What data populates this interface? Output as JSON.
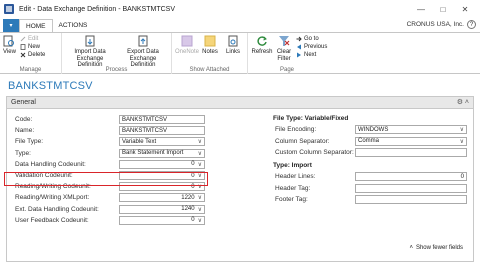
{
  "window": {
    "title": "Edit - Data Exchange Definition - BANKSTMTCSV",
    "minimize": "—",
    "maximize": "□",
    "close": "✕"
  },
  "tabs": [
    "HOME",
    "ACTIONS"
  ],
  "menu_icon": "▾",
  "company": "CRONUS USA, Inc.",
  "help_icon": "?",
  "ribbon": {
    "manage": {
      "label": "Manage",
      "view": "View",
      "edit": "Edit",
      "new": "New",
      "delete": "Delete"
    },
    "process": {
      "label": "Process",
      "import": "Import Data Exchange Definition",
      "export": "Export Data Exchange Definition"
    },
    "show_attached": {
      "label": "Show Attached",
      "onenote": "OneNote",
      "notes": "Notes",
      "links": "Links"
    },
    "page": {
      "label": "Page",
      "refresh": "Refresh",
      "clear_filter": "Clear Filter",
      "goto": "Go to",
      "previous": "Previous",
      "next": "Next"
    }
  },
  "page_title": "BANKSTMTCSV",
  "general": {
    "header": "General",
    "header_icons": "⚙ ˄",
    "left_fields": [
      {
        "label": "Code:",
        "value": "BANKSTMTCSV",
        "type": "text"
      },
      {
        "label": "Name:",
        "value": "BANKSTMTCSV",
        "type": "text"
      },
      {
        "label": "File Type:",
        "value": "Variable Text",
        "type": "select"
      },
      {
        "label": "Type:",
        "value": "Bank Statement Import",
        "type": "select"
      },
      {
        "label": "Data Handling Codeunit:",
        "value": "0",
        "type": "num"
      },
      {
        "label": "Validation Codeunit:",
        "value": "0",
        "type": "num"
      },
      {
        "label": "Reading/Writing Codeunit:",
        "value": "0",
        "type": "num"
      },
      {
        "label": "Reading/Writing XMLport:",
        "value": "1220",
        "type": "num"
      },
      {
        "label": "Ext. Data Handling Codeunit:",
        "value": "1240",
        "type": "num"
      },
      {
        "label": "User Feedback Codeunit:",
        "value": "0",
        "type": "num"
      }
    ],
    "file_type_section": "File Type: Variable/Fixed",
    "right_fields_1": [
      {
        "label": "File Encoding:",
        "value": "WINDOWS",
        "type": "select"
      },
      {
        "label": "Column Separator:",
        "value": "Comma",
        "type": "select"
      },
      {
        "label": "Custom Column Separator:",
        "value": "",
        "type": "text"
      }
    ],
    "import_section": "Type: Import",
    "right_fields_2": [
      {
        "label": "Header Lines:",
        "value": "0",
        "type": "num"
      },
      {
        "label": "Header Tag:",
        "value": "",
        "type": "text"
      },
      {
        "label": "Footer Tag:",
        "value": "",
        "type": "text"
      }
    ],
    "show_fewer": "Show fewer fields",
    "show_fewer_icon": "˄"
  },
  "colors": {
    "accent": "#2d7ab9",
    "highlight": "#d9252a"
  }
}
